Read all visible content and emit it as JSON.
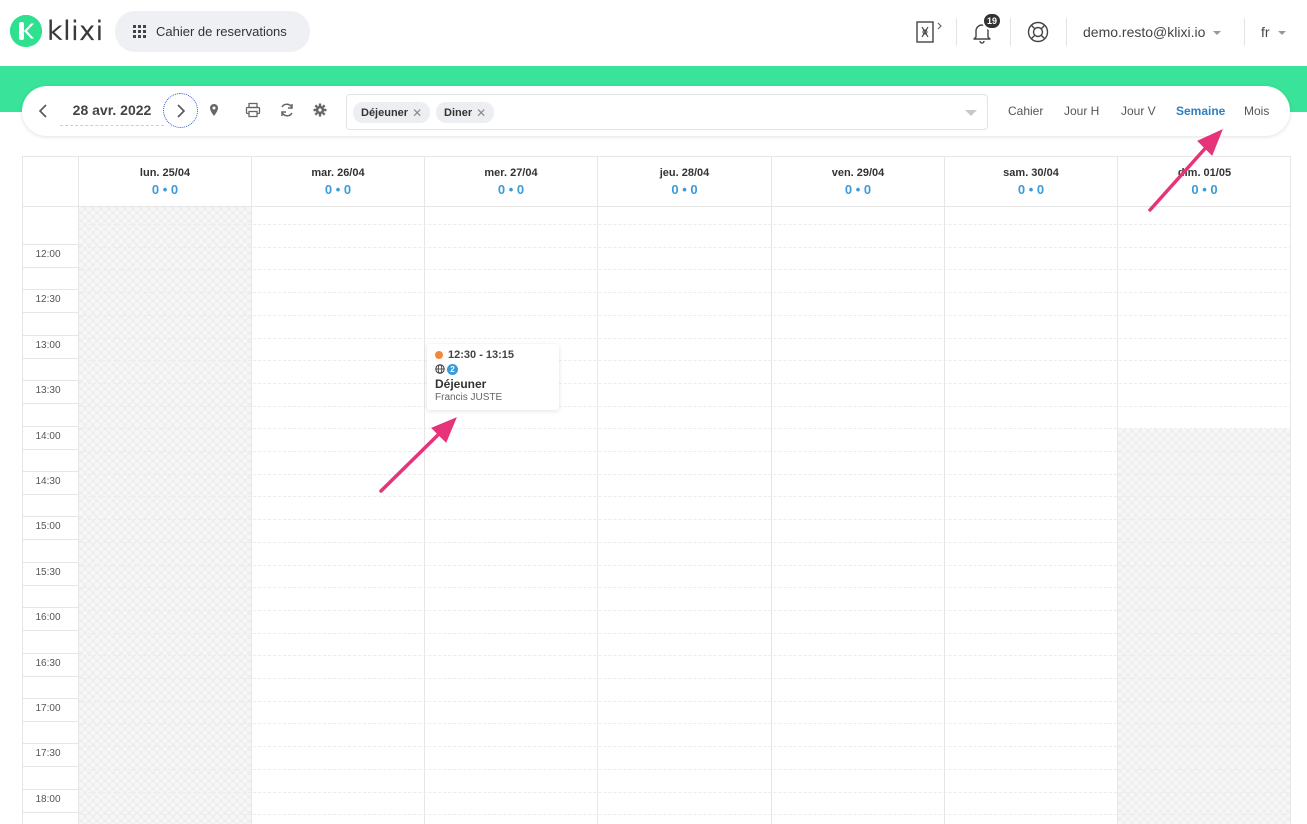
{
  "header": {
    "logo_text": "klixi",
    "app_name": "Cahier de reservations",
    "notifications_count": "19",
    "user_email": "demo.resto@klixi.io",
    "language": "fr"
  },
  "toolbar": {
    "date": "28 avr. 2022",
    "services": [
      "Déjeuner",
      "Diner"
    ],
    "views": [
      "Cahier",
      "Jour H",
      "Jour V",
      "Semaine",
      "Mois"
    ],
    "active_view": "Semaine"
  },
  "calendar": {
    "days": [
      {
        "label": "lun. 25/04",
        "count": "0 • 0"
      },
      {
        "label": "mar. 26/04",
        "count": "0 • 0"
      },
      {
        "label": "mer. 27/04",
        "count": "0 • 0"
      },
      {
        "label": "jeu. 28/04",
        "count": "0 • 0"
      },
      {
        "label": "ven. 29/04",
        "count": "0 • 0"
      },
      {
        "label": "sam. 30/04",
        "count": "0 • 0"
      },
      {
        "label": "dim. 01/05",
        "count": "0 • 0"
      }
    ],
    "times": [
      "12:00",
      "12:30",
      "13:00",
      "13:30",
      "14:00",
      "14:30",
      "15:00",
      "15:30",
      "16:00",
      "16:30",
      "17:00",
      "17:30",
      "18:00"
    ],
    "event": {
      "time": "12:30 - 13:15",
      "guests": "2",
      "title": "Déjeuner",
      "client": "Francis JUSTE",
      "status_color": "#f2883a"
    }
  },
  "colors": {
    "brand_green": "#39e39a",
    "accent_blue": "#2f7fc1",
    "annotation_pink": "#e6337a"
  }
}
